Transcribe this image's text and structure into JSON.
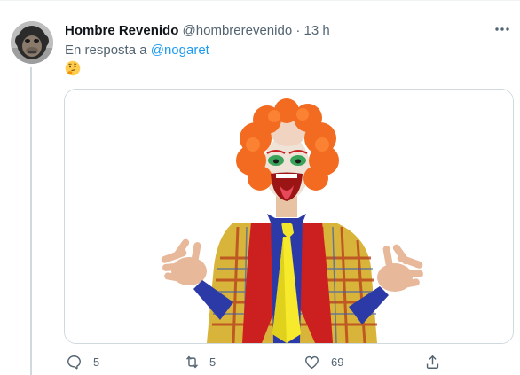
{
  "tweet": {
    "author_name": "Hombre Revenido",
    "handle": "@hombrerevenido",
    "separator": "·",
    "time": "13 h",
    "more_icon": "ellipsis-icon",
    "reply_prefix": "En resposta a",
    "reply_mention": "@nogaret",
    "content_emoji": "thinking-face-emoji",
    "media": {
      "alt": "clown-image"
    }
  },
  "actions": {
    "reply": {
      "icon": "reply-icon",
      "count": "5"
    },
    "retweet": {
      "icon": "retweet-icon",
      "count": "5"
    },
    "like": {
      "icon": "heart-icon",
      "count": "69"
    },
    "share": {
      "icon": "share-icon"
    }
  },
  "colors": {
    "text_primary": "#0f1419",
    "text_secondary": "#536471",
    "accent": "#1d9bf0",
    "border": "#cfd9de"
  }
}
